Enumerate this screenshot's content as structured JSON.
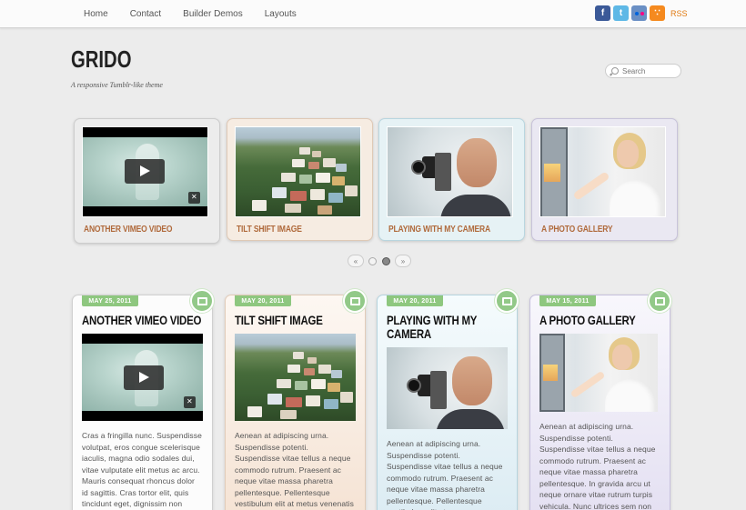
{
  "nav": {
    "items": [
      "Home",
      "Contact",
      "Builder Demos",
      "Layouts"
    ]
  },
  "social": {
    "rss_label": "RSS",
    "icons": [
      "facebook-icon",
      "twitter-icon",
      "flickr-icon",
      "rss-icon"
    ]
  },
  "header": {
    "logo": "GRIDO",
    "tagline": "A responsive Tumblr-like theme"
  },
  "search": {
    "placeholder": "Search"
  },
  "slider": {
    "slides": [
      {
        "caption": "ANOTHER VIMEO VIDEO"
      },
      {
        "caption": "TILT SHIFT IMAGE"
      },
      {
        "caption": "PLAYING WITH MY CAMERA"
      },
      {
        "caption": "A PHOTO GALLERY"
      }
    ],
    "prev": "«",
    "next": "»"
  },
  "posts": [
    {
      "date": "MAY 25, 2011",
      "title": "ANOTHER VIMEO VIDEO",
      "body": "Cras a fringilla nunc. Suspendisse volutpat, eros congue scelerisque iaculis, magna odio sodales dui, vitae vulputate elit metus ac arcu. Mauris consequat rhoncus dolor id sagittis. Cras tortor elit, quis tincidunt eget, dignissim non"
    },
    {
      "date": "MAY 20, 2011",
      "title": "TILT SHIFT IMAGE",
      "body": "Aenean at adipiscing urna. Suspendisse potenti. Suspendisse vitae tellus a neque commodo rutrum. Praesent ac neque vitae massa pharetra pellentesque. Pellentesque vestibulum elit at metus venenatis non faucibus"
    },
    {
      "date": "MAY 20, 2011",
      "title": "PLAYING WITH MY CAMERA",
      "body": "Aenean at adipiscing urna. Suspendisse potenti. Suspendisse vitae tellus a neque commodo rutrum. Praesent ac neque vitae massa pharetra pellentesque. Pellentesque vestibulum elit at"
    },
    {
      "date": "MAY 15, 2011",
      "title": "A PHOTO GALLERY",
      "body": "Aenean at adipiscing urna. Suspendisse potenti. Suspendisse vitae tellus a neque commodo rutrum. Praesent ac neque vitae massa pharetra pellentesque. In gravida arcu ut neque ornare vitae rutrum turpis vehicula. Nunc ultrices sem non mollis mattis"
    }
  ],
  "colors": {
    "date_badge": "#8ec77f",
    "caption": "#b06a3c"
  }
}
